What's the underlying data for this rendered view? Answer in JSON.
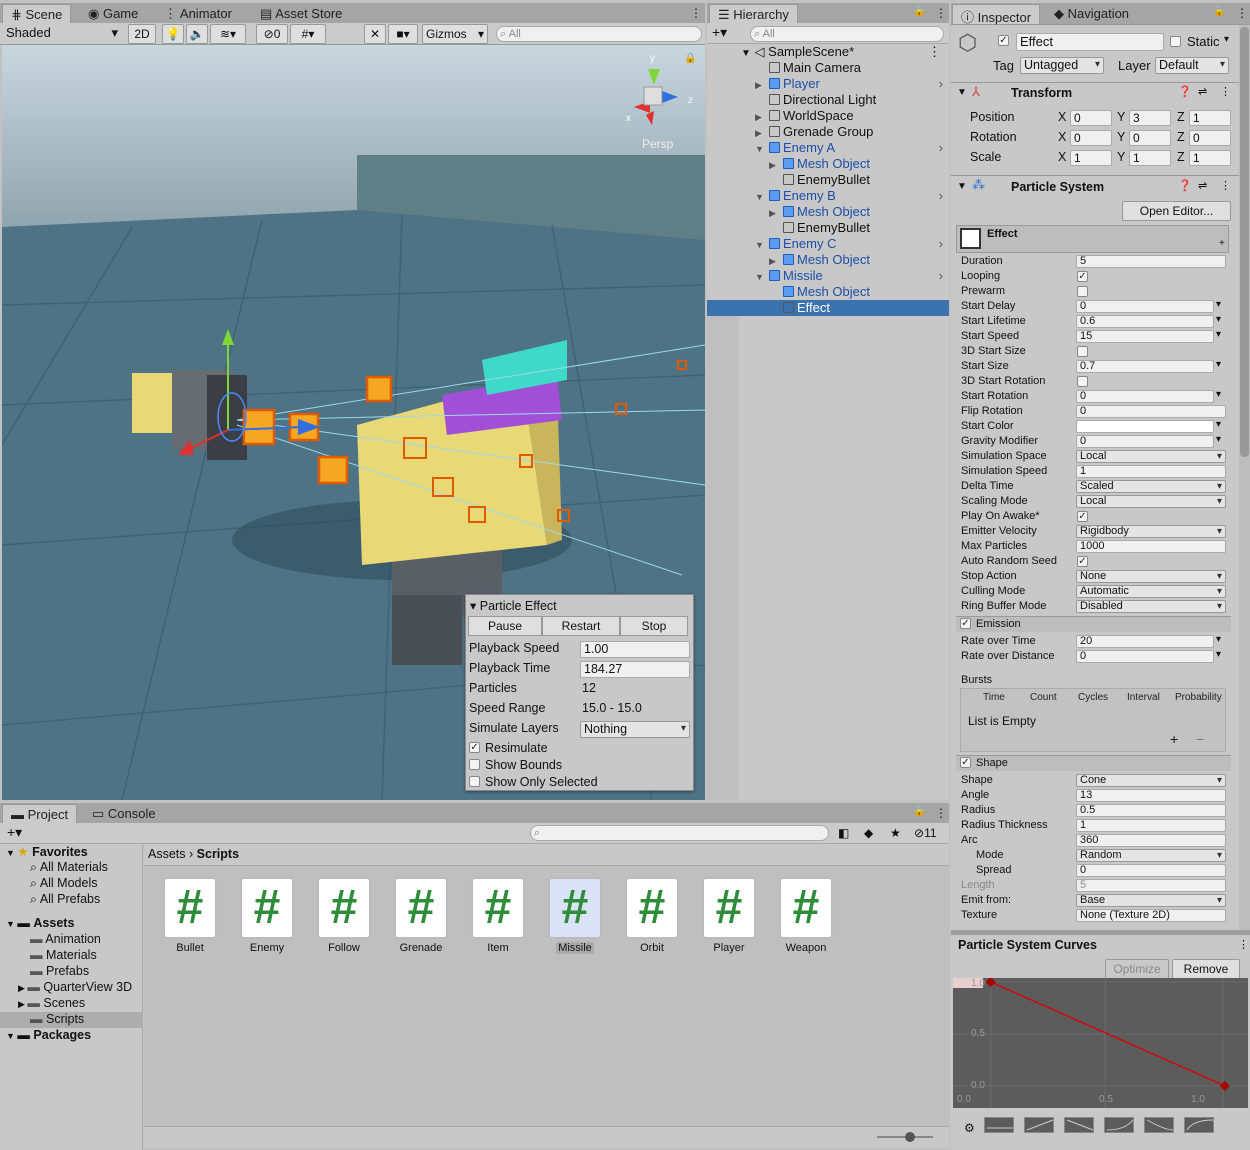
{
  "scene": {
    "tabs": [
      "Scene",
      "Game",
      "Animator",
      "Asset Store"
    ],
    "shading": "Shaded",
    "btn_2d": "2D",
    "hidden_count": "0",
    "gizmos": "Gizmos",
    "search_placeholder": "All",
    "persp": "Persp"
  },
  "particle_effect": {
    "title": "Particle Effect",
    "pause": "Pause",
    "restart": "Restart",
    "stop": "Stop",
    "rows": [
      {
        "label": "Playback Speed",
        "value": "1.00"
      },
      {
        "label": "Playback Time",
        "value": "184.27"
      },
      {
        "label": "Particles",
        "value": "12"
      },
      {
        "label": "Speed Range",
        "value": "15.0 - 15.0"
      },
      {
        "label": "Simulate Layers",
        "value": "Nothing"
      }
    ],
    "checks": [
      {
        "label": "Resimulate",
        "checked": true
      },
      {
        "label": "Show Bounds",
        "checked": false
      },
      {
        "label": "Show Only Selected",
        "checked": false
      }
    ]
  },
  "hierarchy": {
    "tab": "Hierarchy",
    "search_placeholder": "All",
    "scene": "SampleScene*",
    "items": [
      {
        "label": "Main Camera",
        "indent": 1,
        "blue": false,
        "arrow": false
      },
      {
        "label": "Player",
        "indent": 1,
        "blue": true,
        "arrow": true,
        "more": true
      },
      {
        "label": "Directional Light",
        "indent": 1,
        "blue": false,
        "arrow": false
      },
      {
        "label": "WorldSpace",
        "indent": 1,
        "blue": false,
        "arrow": true
      },
      {
        "label": "Grenade Group",
        "indent": 1,
        "blue": false,
        "arrow": true
      },
      {
        "label": "Enemy A",
        "indent": 1,
        "blue": true,
        "arrow": true,
        "open": true,
        "more": true
      },
      {
        "label": "Mesh Object",
        "indent": 2,
        "blue": true,
        "arrow": true
      },
      {
        "label": "EnemyBullet",
        "indent": 2,
        "blue": false,
        "arrow": false
      },
      {
        "label": "Enemy B",
        "indent": 1,
        "blue": true,
        "arrow": true,
        "open": true,
        "more": true
      },
      {
        "label": "Mesh Object",
        "indent": 2,
        "blue": true,
        "arrow": true
      },
      {
        "label": "EnemyBullet",
        "indent": 2,
        "blue": false,
        "arrow": false
      },
      {
        "label": "Enemy C",
        "indent": 1,
        "blue": true,
        "arrow": true,
        "open": true,
        "more": true
      },
      {
        "label": "Mesh Object",
        "indent": 2,
        "blue": true,
        "arrow": true
      },
      {
        "label": "Missile",
        "indent": 1,
        "blue": true,
        "arrow": true,
        "open": true,
        "more": true
      },
      {
        "label": "Mesh Object",
        "indent": 2,
        "blue": true,
        "arrow": false
      },
      {
        "label": "Effect",
        "indent": 2,
        "blue": false,
        "arrow": false,
        "selected": true
      }
    ]
  },
  "inspector": {
    "tabs": [
      "Inspector",
      "Navigation"
    ],
    "name": "Effect",
    "static": "Static",
    "tag_label": "Tag",
    "tag": "Untagged",
    "layer_label": "Layer",
    "layer": "Default",
    "transform": {
      "title": "Transform",
      "rows": [
        {
          "label": "Position",
          "x": "0",
          "y": "3",
          "z": "1"
        },
        {
          "label": "Rotation",
          "x": "0",
          "y": "0",
          "z": "0"
        },
        {
          "label": "Scale",
          "x": "1",
          "y": "1",
          "z": "1"
        }
      ]
    },
    "ps": {
      "title": "Particle System",
      "open_editor": "Open Editor...",
      "effect": "Effect",
      "props": [
        {
          "l": "Duration",
          "t": "f",
          "v": "5"
        },
        {
          "l": "Looping",
          "t": "c",
          "v": true
        },
        {
          "l": "Prewarm",
          "t": "c",
          "v": false
        },
        {
          "l": "Start Delay",
          "t": "fd",
          "v": "0"
        },
        {
          "l": "Start Lifetime",
          "t": "fd",
          "v": "0.6"
        },
        {
          "l": "Start Speed",
          "t": "fd",
          "v": "15"
        },
        {
          "l": "3D Start Size",
          "t": "c",
          "v": false
        },
        {
          "l": "Start Size",
          "t": "fd",
          "v": "0.7"
        },
        {
          "l": "3D Start Rotation",
          "t": "c",
          "v": false
        },
        {
          "l": "Start Rotation",
          "t": "fd",
          "v": "0"
        },
        {
          "l": "Flip Rotation",
          "t": "f",
          "v": "0"
        },
        {
          "l": "Start Color",
          "t": "fd",
          "v": ""
        },
        {
          "l": "Gravity Modifier",
          "t": "fd",
          "v": "0"
        },
        {
          "l": "Simulation Space",
          "t": "d",
          "v": "Local"
        },
        {
          "l": "Simulation Speed",
          "t": "f",
          "v": "1"
        },
        {
          "l": "Delta Time",
          "t": "d",
          "v": "Scaled"
        },
        {
          "l": "Scaling Mode",
          "t": "d",
          "v": "Local"
        },
        {
          "l": "Play On Awake*",
          "t": "c",
          "v": true
        },
        {
          "l": "Emitter Velocity",
          "t": "d",
          "v": "Rigidbody"
        },
        {
          "l": "Max Particles",
          "t": "f",
          "v": "1000"
        },
        {
          "l": "Auto Random Seed",
          "t": "c",
          "v": true
        },
        {
          "l": "Stop Action",
          "t": "d",
          "v": "None"
        },
        {
          "l": "Culling Mode",
          "t": "d",
          "v": "Automatic"
        },
        {
          "l": "Ring Buffer Mode",
          "t": "d",
          "v": "Disabled"
        }
      ],
      "emission": {
        "title": "Emission",
        "rows": [
          {
            "l": "Rate over Time",
            "v": "20"
          },
          {
            "l": "Rate over Distance",
            "v": "0"
          }
        ],
        "bursts": "Bursts",
        "cols": [
          "Time",
          "Count",
          "Cycles",
          "Interval",
          "Probability"
        ],
        "empty": "List is Empty"
      },
      "shape": {
        "title": "Shape",
        "rows": [
          {
            "l": "Shape",
            "t": "d",
            "v": "Cone"
          },
          {
            "l": "Angle",
            "t": "f",
            "v": "13"
          },
          {
            "l": "Radius",
            "t": "f",
            "v": "0.5"
          },
          {
            "l": "Radius Thickness",
            "t": "f",
            "v": "1"
          },
          {
            "l": "Arc",
            "t": "f",
            "v": "360"
          },
          {
            "l": "Mode",
            "t": "d",
            "v": "Random",
            "sub": true
          },
          {
            "l": "Spread",
            "t": "f",
            "v": "0",
            "sub": true
          },
          {
            "l": "Length",
            "t": "f",
            "v": "5",
            "dis": true
          },
          {
            "l": "Emit from:",
            "t": "d",
            "v": "Base"
          },
          {
            "l": "Texture",
            "t": "f",
            "v": "None (Texture 2D)"
          }
        ]
      }
    },
    "curves": {
      "title": "Particle System Curves",
      "optimize": "Optimize",
      "remove": "Remove",
      "y_ticks": [
        "1.0",
        "0.5",
        "0.0"
      ],
      "x_ticks": [
        "0.0",
        "0.5",
        "1.0"
      ]
    }
  },
  "project": {
    "tabs": [
      "Project",
      "Console"
    ],
    "hidden": "11",
    "breadcrumb": [
      "Assets",
      "Scripts"
    ],
    "tree": [
      {
        "label": "Favorites",
        "bold": true,
        "indent": 0
      },
      {
        "label": "All Materials",
        "indent": 1
      },
      {
        "label": "All Models",
        "indent": 1
      },
      {
        "label": "All Prefabs",
        "indent": 1
      },
      {
        "label": "Assets",
        "bold": true,
        "indent": 0,
        "gap": true
      },
      {
        "label": "Animation",
        "indent": 1
      },
      {
        "label": "Materials",
        "indent": 1
      },
      {
        "label": "Prefabs",
        "indent": 1
      },
      {
        "label": "QuarterView 3D",
        "indent": 1
      },
      {
        "label": "Scenes",
        "indent": 1
      },
      {
        "label": "Scripts",
        "indent": 1,
        "selected": true
      },
      {
        "label": "Packages",
        "bold": true,
        "indent": 0
      }
    ],
    "assets": [
      "Bullet",
      "Enemy",
      "Follow",
      "Grenade",
      "Item",
      "Missile",
      "Orbit",
      "Player",
      "Weapon"
    ],
    "selected_asset": "Missile"
  }
}
